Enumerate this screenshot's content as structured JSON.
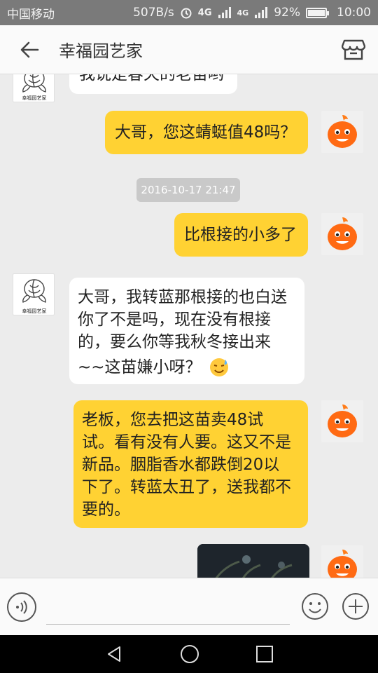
{
  "status_bar": {
    "carrier": "中国移动",
    "speed": "507B/s",
    "network1": "4G",
    "network2": "4G",
    "battery_level": "92%",
    "battery_fraction": 0.92,
    "time": "10:00"
  },
  "header": {
    "title": "幸福园艺家",
    "back_icon": "arrow-left-icon",
    "store_icon": "store-icon"
  },
  "shop_avatar_label": "幸福园艺家",
  "messages": [
    {
      "sender": "them",
      "text": "我说是春天的老苗哟"
    },
    {
      "sender": "me",
      "text": "大哥，您这蜻蜓值48吗？"
    },
    {
      "sender": "system",
      "text": "2016-10-17 21:47"
    },
    {
      "sender": "me",
      "text": "比根接的小多了"
    },
    {
      "sender": "them",
      "lines": [
        "大哥，我转蓝那根接的也白送",
        "你了不是吗，现在没有根接",
        "的，要么你等我秋冬接出来",
        "~~这苗嫌小呀？"
      ]
    },
    {
      "sender": "me",
      "lines": [
        "老板，您去把这苗卖48试",
        "试。看有没有人要。这又不是",
        "新品。胭脂香水都跌倒20以",
        "下了。转蓝太丑了，送我都不",
        "要的。"
      ]
    },
    {
      "sender": "me",
      "type": "image"
    }
  ],
  "input": {
    "placeholder": "",
    "voice_icon": "voice-icon",
    "emoji_icon": "emoji-icon",
    "plus_icon": "plus-icon"
  },
  "nav": {
    "back": "nav-back-icon",
    "home": "nav-home-icon",
    "recent": "nav-recent-icon"
  },
  "colors": {
    "my_bubble": "#ffd233",
    "their_bubble": "#ffffff",
    "background": "#ececec",
    "status_bar": "#7a7a7a"
  }
}
